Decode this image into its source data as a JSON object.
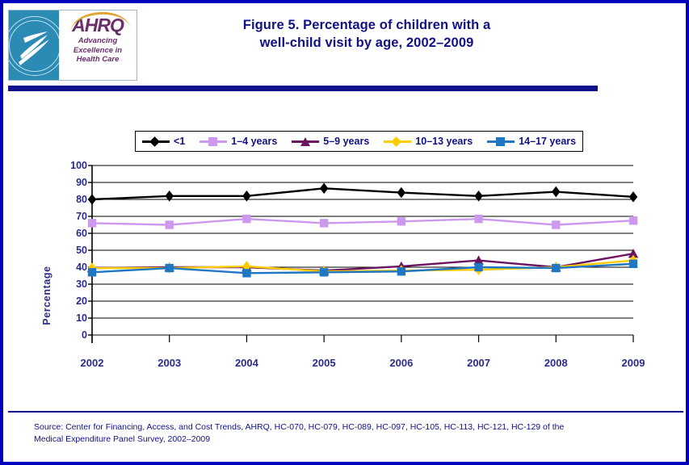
{
  "header": {
    "title_line1": "Figure 5. Percentage of children with a",
    "title_line2": "well-child visit by age, 2002–2009",
    "logo": {
      "agency_acronym": "AHRQ",
      "tagline_line1": "Advancing",
      "tagline_line2": "Excellence in",
      "tagline_line3": "Health Care",
      "seal_name": "hhs-seal-icon"
    }
  },
  "footer": {
    "source_line1": "Source: Center for Financing, Access, and Cost Trends, AHRQ,  HC-070, HC-079, HC-089, HC-097, HC-105, HC-113, HC-121, HC-129 of the",
    "source_line2": "Medical Expenditure Panel Survey,  2002–2009"
  },
  "colors": {
    "border": "#0000bb",
    "title_text": "#111186",
    "axis_text": "#2b2b8c",
    "rule": "#10108c",
    "series_under1": "#000000",
    "series_1_4": "#cc99ee",
    "series_5_9": "#6b1560",
    "series_10_13": "#ffcc00",
    "series_14_17": "#1f77c4"
  },
  "chart_data": {
    "type": "line",
    "title": "Figure 5. Percentage of children with a well-child visit by age, 2002–2009",
    "xlabel": "",
    "ylabel": "Percentage",
    "categories": [
      "2002",
      "2003",
      "2004",
      "2005",
      "2006",
      "2007",
      "2008",
      "2009"
    ],
    "ylim": [
      0,
      100
    ],
    "yticks": [
      0,
      10,
      20,
      30,
      40,
      50,
      60,
      70,
      80,
      90,
      100
    ],
    "grid": true,
    "legend_position": "top",
    "series": [
      {
        "name": "<1",
        "color": "#000000",
        "marker": "diamond",
        "values": [
          80.0,
          82.0,
          82.0,
          86.5,
          84.0,
          82.0,
          84.5,
          81.5
        ]
      },
      {
        "name": "1–4 years",
        "color": "#cc99ee",
        "marker": "square",
        "values": [
          66.0,
          65.0,
          68.5,
          66.0,
          67.0,
          68.5,
          65.0,
          67.5
        ]
      },
      {
        "name": "5–9 years",
        "color": "#6b1560",
        "marker": "triangle",
        "values": [
          39.5,
          40.0,
          40.0,
          38.0,
          40.5,
          44.0,
          40.0,
          48.0
        ]
      },
      {
        "name": "10–13 years",
        "color": "#ffcc00",
        "marker": "diamond",
        "values": [
          39.5,
          39.5,
          40.5,
          37.5,
          38.0,
          38.5,
          40.0,
          44.0
        ]
      },
      {
        "name": "14–17 years",
        "color": "#1f77c4",
        "marker": "square",
        "values": [
          37.0,
          39.5,
          36.5,
          37.0,
          37.5,
          40.0,
          39.5,
          42.0
        ]
      }
    ]
  }
}
